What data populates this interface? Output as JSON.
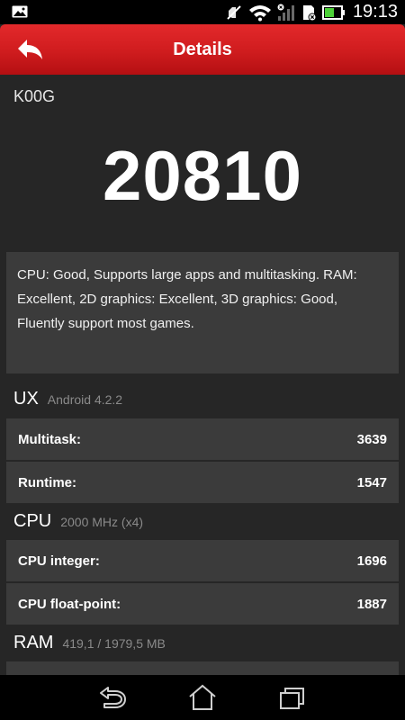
{
  "status_bar": {
    "time": "19:13",
    "icons": [
      "gallery-icon",
      "mute-icon",
      "wifi-icon",
      "signal-icon",
      "sd-card-icon",
      "battery-icon"
    ]
  },
  "header": {
    "title": "Details",
    "back_icon": "back-arrow-icon",
    "accent_color": "#cf1c1e"
  },
  "device": {
    "name": "K00G",
    "score": "20810",
    "summary": "CPU: Good, Supports large apps and multitasking. RAM: Excellent, 2D graphics: Excellent, 3D graphics: Good, Fluently support most games."
  },
  "sections": {
    "ux": {
      "title": "UX",
      "subtitle": "Android 4.2.2",
      "rows": [
        {
          "label": "Multitask:",
          "value": "3639"
        },
        {
          "label": "Runtime:",
          "value": "1547"
        }
      ]
    },
    "cpu": {
      "title": "CPU",
      "subtitle": "2000 MHz (x4)",
      "rows": [
        {
          "label": "CPU integer:",
          "value": "1696"
        },
        {
          "label": "CPU float-point:",
          "value": "1887"
        }
      ]
    },
    "ram": {
      "title": "RAM",
      "subtitle": "419,1 / 1979,5 MB"
    }
  },
  "nav_bar": {
    "buttons": [
      "back-icon",
      "home-icon",
      "recent-apps-icon"
    ]
  }
}
